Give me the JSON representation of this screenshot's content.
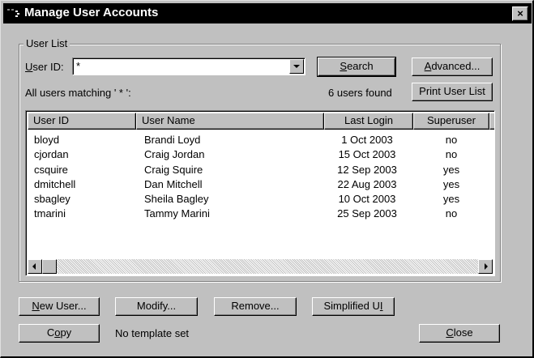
{
  "window": {
    "title": "Manage User Accounts",
    "close_glyph": "×"
  },
  "user_list": {
    "group_label": "User List",
    "user_id_label": {
      "pre": "",
      "key": "U",
      "post": "ser ID:"
    },
    "user_id_value": "*",
    "matching_text": "All users matching ' * ':",
    "found_text": "6 users found",
    "search_button": {
      "pre": "",
      "key": "S",
      "post": "earch"
    },
    "advanced_button": {
      "pre": "",
      "key": "A",
      "post": "dvanced..."
    },
    "print_button": "Print User List"
  },
  "table": {
    "columns": [
      "User ID",
      "User Name",
      "Last Login",
      "Superuser"
    ],
    "rows": [
      {
        "id": "bloyd",
        "name": "Brandi Loyd",
        "login": "1  Oct 2003",
        "super": "no"
      },
      {
        "id": "cjordan",
        "name": "Craig Jordan",
        "login": "15 Oct 2003",
        "super": "no"
      },
      {
        "id": "csquire",
        "name": "Craig Squire",
        "login": "12 Sep 2003",
        "super": "yes"
      },
      {
        "id": "dmitchell",
        "name": "Dan Mitchell",
        "login": "22 Aug 2003",
        "super": "yes"
      },
      {
        "id": "sbagley",
        "name": "Sheila Bagley",
        "login": "10 Oct 2003",
        "super": "yes"
      },
      {
        "id": "tmarini",
        "name": "Tammy Marini",
        "login": "25 Sep 2003",
        "super": "no"
      }
    ]
  },
  "buttons": {
    "new_user": {
      "pre": "",
      "key": "N",
      "post": "ew User..."
    },
    "modify": "Modify...",
    "remove": "Remove...",
    "simplified": {
      "pre": "Simplified U",
      "key": "I",
      "post": ""
    },
    "copy": {
      "pre": "C",
      "key": "o",
      "post": "py"
    },
    "close": {
      "pre": "",
      "key": "C",
      "post": "lose"
    }
  },
  "template_status": "No template set",
  "icons": {
    "app": "terminal-icon",
    "close": "close-icon",
    "dropdown": "chevron-down-icon",
    "scroll_left": "arrow-left-icon",
    "scroll_right": "arrow-right-icon"
  }
}
